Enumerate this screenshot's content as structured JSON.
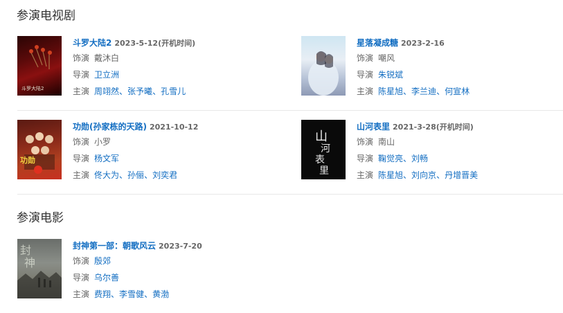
{
  "sections": {
    "tv_title": "参演电视剧",
    "movie_title": "参演电影"
  },
  "labels": {
    "role": "饰演",
    "director": "导演",
    "cast": "主演"
  },
  "tv": [
    {
      "name": "斗罗大陆2",
      "date": "2023-5-12(开机时间)",
      "role": "戴沐白",
      "director": "卫立洲",
      "cast": [
        "周翊然",
        "张予曦",
        "孔雪儿"
      ],
      "poster_text": "斗罗大陆2"
    },
    {
      "name": "星落凝成糖",
      "date": "2023-2-16",
      "role": "嘲风",
      "director": "朱锐斌",
      "cast": [
        "陈星旭",
        "李兰迪",
        "何宣林"
      ]
    },
    {
      "name": "功勋(孙家栋的天路)",
      "date": "2021-10-12",
      "role": "小罗",
      "director": "杨文军",
      "cast": [
        "佟大为",
        "孙俪",
        "刘奕君"
      ],
      "poster_text": "功勋"
    },
    {
      "name": "山河表里",
      "date": "2021-3-28(开机时间)",
      "role": "南山",
      "director": "鞠觉亮、刘畅",
      "cast": [
        "陈星旭",
        "刘向京",
        "丹增晋美"
      ],
      "poster_text": "山河表里"
    }
  ],
  "movies": [
    {
      "name": "封神第一部：朝歌风云",
      "date": "2023-7-20",
      "role": "殷郊",
      "director": "乌尔善",
      "cast": [
        "费翔",
        "李雪健",
        "黄渤"
      ],
      "poster_text": "封神"
    }
  ]
}
